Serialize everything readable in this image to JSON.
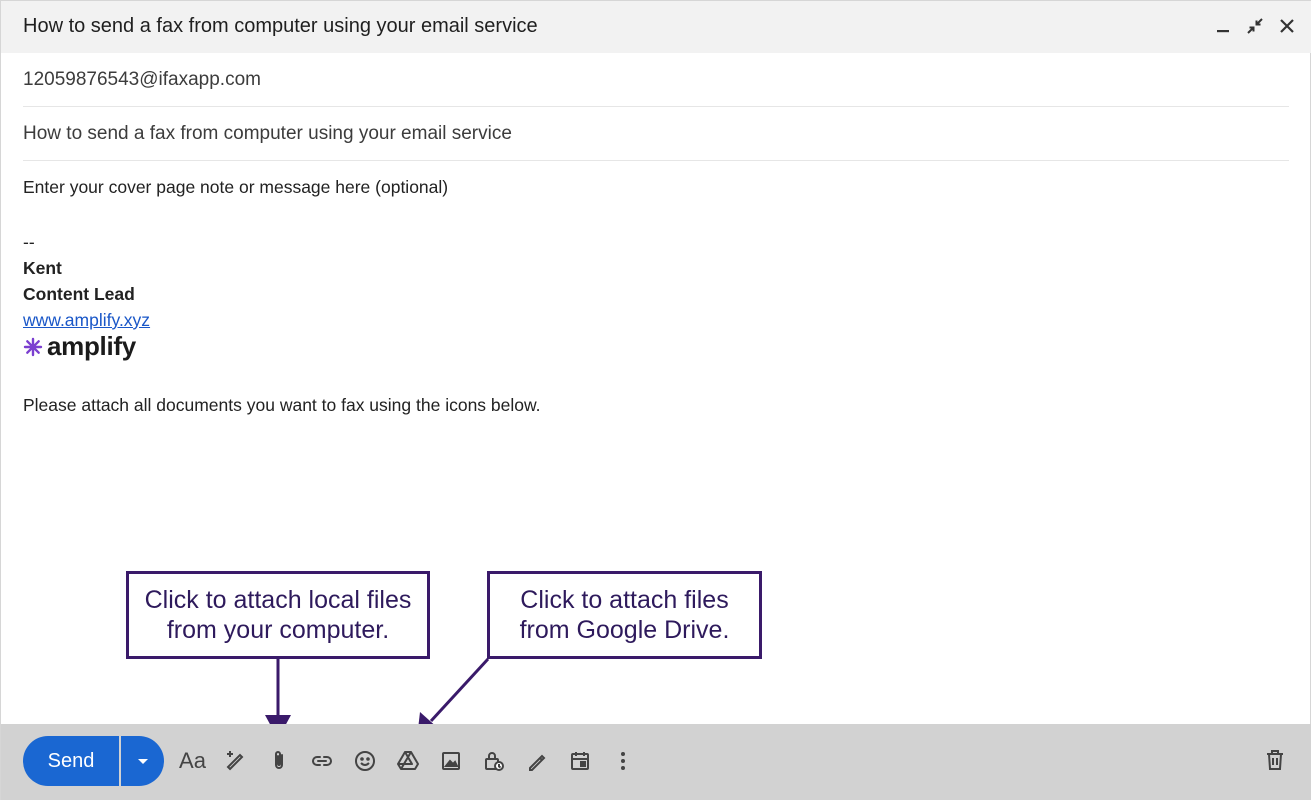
{
  "window": {
    "title": "How to send a fax from computer using your email service"
  },
  "compose": {
    "to": "12059876543@ifaxapp.com",
    "subject": "How to send a fax from computer using your email service",
    "body": {
      "cover_note": "Enter your cover page note or message here (optional)",
      "signature_dashes": "--",
      "signature_name": "Kent",
      "signature_role": "Content Lead",
      "signature_link": "www.amplify.xyz",
      "logo_text": "amplify",
      "instructions": "Please attach all documents you want to fax using the icons below."
    }
  },
  "callouts": {
    "local_files": "Click to attach local files\nfrom your computer.",
    "google_drive": "Click to attach files\nfrom Google Drive."
  },
  "toolbar": {
    "send_label": "Send",
    "format_label": "Aa",
    "icons": [
      "formatting",
      "ai-write",
      "attach-file",
      "insert-link",
      "emoji",
      "google-drive",
      "insert-photo",
      "confidential-mode",
      "signature",
      "schedule",
      "more-options",
      "discard"
    ]
  },
  "colors": {
    "send_blue": "#1a67d2",
    "callout_purple": "#3a1a6a",
    "logo_purple": "#7b3fd0",
    "link_blue": "#1a57c8"
  }
}
